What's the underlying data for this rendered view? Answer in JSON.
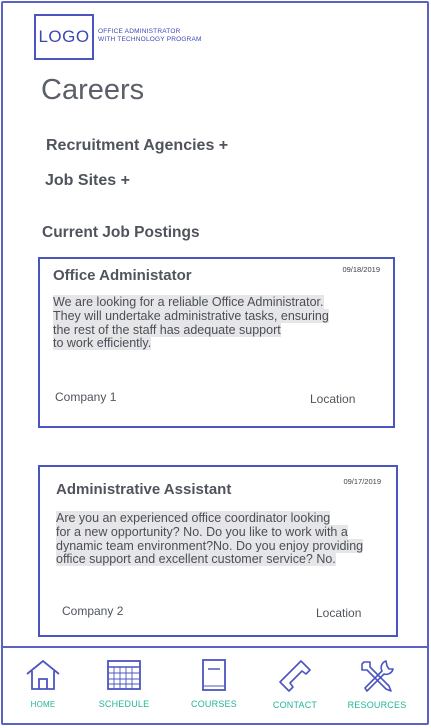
{
  "header": {
    "logo": "LOGO",
    "program_line1": "OFFICE ADMINISTRATOR",
    "program_line2": "WITH TECHNOLOGY PROGRAM"
  },
  "page": {
    "title": "Careers"
  },
  "expanders": [
    {
      "label": "Recruitment Agencies +"
    },
    {
      "label": "Job Sites +"
    }
  ],
  "postings": {
    "section_title": "Current Job Postings",
    "items": [
      {
        "title": "Office Administator",
        "date": "09/18/2019",
        "description_lines": [
          "We are looking for a reliable Office Administrator.",
          "They will undertake administrative tasks, ensuring",
          "the rest of the staff has adequate support",
          "to work efficiently."
        ],
        "company": "Company 1",
        "location": "Location"
      },
      {
        "title": "Administrative Assistant",
        "date": "09/17/2019",
        "description_lines": [
          "Are you an experienced office coordinator looking",
          "for a new opportunity? No. Do you like to work with a",
          "dynamic team environment?No. Do you enjoy providing",
          "office support and excellent customer service? No."
        ],
        "company": "Company 2",
        "location": "Location"
      }
    ]
  },
  "nav": {
    "items": [
      {
        "label": "HOME",
        "icon": "home-icon"
      },
      {
        "label": "SCHEDULE",
        "icon": "calendar-icon"
      },
      {
        "label": "COURSES",
        "icon": "book-icon"
      },
      {
        "label": "CONTACT",
        "icon": "phone-icon"
      },
      {
        "label": "RESOURCES",
        "icon": "tools-icon"
      }
    ]
  },
  "colors": {
    "border": "#4b55c0",
    "nav_label": "#22b59a",
    "text": "#4f545c",
    "highlight": "#e6e6e8"
  }
}
